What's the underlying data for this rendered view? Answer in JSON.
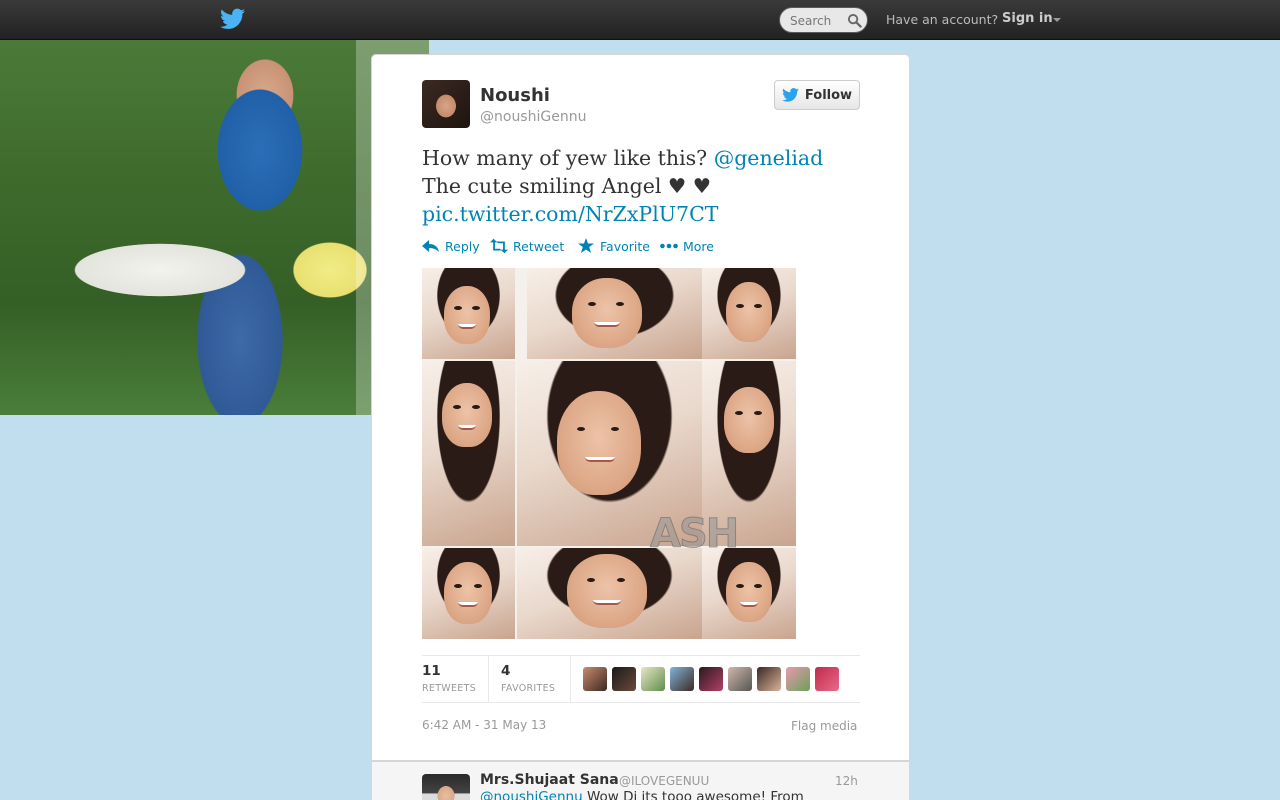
{
  "topbar": {
    "logo_icon": "twitter-bird-icon",
    "search_placeholder": "Search",
    "search_icon": "magnifier-icon",
    "have_account": "Have an account?",
    "sign_in": "Sign in"
  },
  "tweet": {
    "author_name": "Noushi",
    "author_handle": "@noushiGennu",
    "follow_label": "Follow",
    "text_part1": "How many of yew like this? ",
    "mention": "@geneliad",
    "text_part2": " The cute smiling Angel  ♥  ♥",
    "link": "pic.twitter.com/NrZxPlU7CT",
    "actions": {
      "reply": "Reply",
      "retweet": "Retweet",
      "favorite": "Favorite",
      "more": "More"
    },
    "media_watermark": "ASH",
    "stats": {
      "retweets_count": "11",
      "retweets_label": "RETWEETS",
      "favorites_count": "4",
      "favorites_label": "FAVORITES"
    },
    "timestamp": "6:42 AM - 31 May 13",
    "flag_media": "Flag media"
  },
  "reply": {
    "name": "Mrs.Shujaat Sana",
    "handle": "@ILOVEGENUU",
    "time": "12h",
    "mention": "@noushiGennu",
    "text": " Wow Di its tooo awesome! From"
  },
  "colors": {
    "link": "#0084b4",
    "page_bg": "#c0deed",
    "topbar": "#2a2a2a"
  }
}
